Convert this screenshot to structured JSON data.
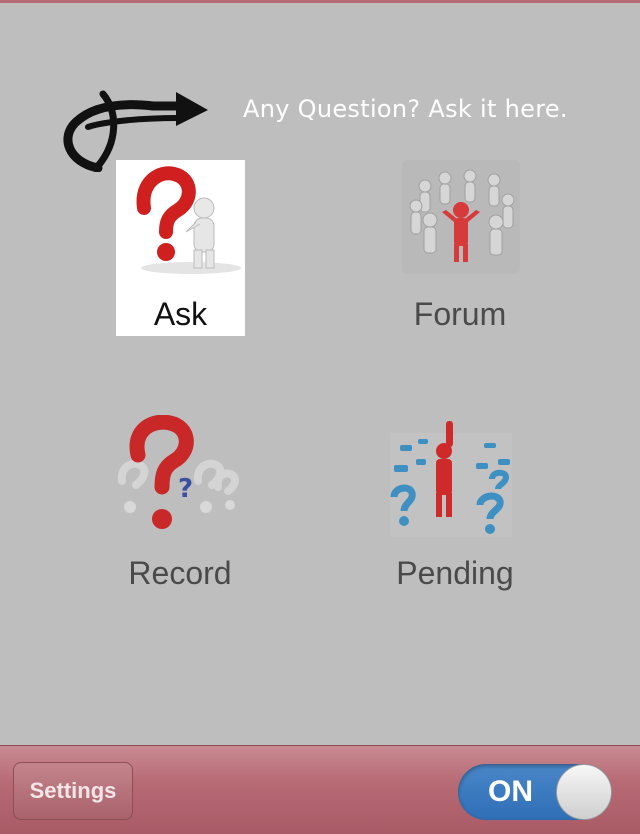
{
  "hint": {
    "text": "Any Question? Ask it here."
  },
  "tiles": [
    {
      "label": "Ask",
      "icon": "question-mark-person-icon"
    },
    {
      "label": "Forum",
      "icon": "group-circle-icon"
    },
    {
      "label": "Record",
      "icon": "question-marks-icon"
    },
    {
      "label": "Pending",
      "icon": "standing-figure-question-marks-icon"
    }
  ],
  "bottom_bar": {
    "settings_label": "Settings",
    "toggle_label": "ON",
    "toggle_state": "on"
  },
  "colors": {
    "background": "#bebebe",
    "bar": "#b76b75",
    "toggle_on": "#3a7bc0",
    "question_red": "#d42a2a",
    "question_blue": "#3a8fc0"
  }
}
